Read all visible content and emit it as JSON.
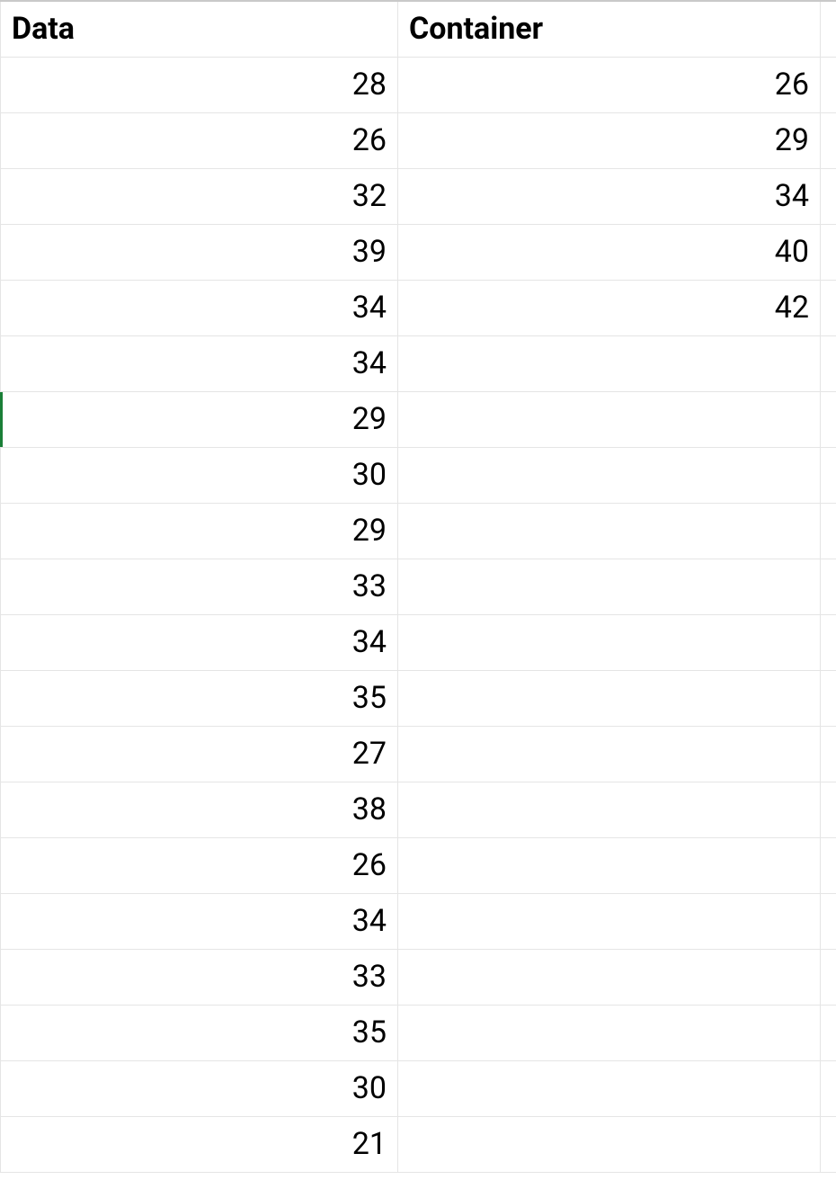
{
  "table": {
    "headers": [
      "Data",
      "Container"
    ],
    "rows": [
      {
        "data": "28",
        "container": "26"
      },
      {
        "data": "26",
        "container": "29"
      },
      {
        "data": "32",
        "container": "34"
      },
      {
        "data": "39",
        "container": "40"
      },
      {
        "data": "34",
        "container": "42"
      },
      {
        "data": "34",
        "container": ""
      },
      {
        "data": "29",
        "container": ""
      },
      {
        "data": "30",
        "container": ""
      },
      {
        "data": "29",
        "container": ""
      },
      {
        "data": "33",
        "container": ""
      },
      {
        "data": "34",
        "container": ""
      },
      {
        "data": "35",
        "container": ""
      },
      {
        "data": "27",
        "container": ""
      },
      {
        "data": "38",
        "container": ""
      },
      {
        "data": "26",
        "container": ""
      },
      {
        "data": "34",
        "container": ""
      },
      {
        "data": "33",
        "container": ""
      },
      {
        "data": "35",
        "container": ""
      },
      {
        "data": "30",
        "container": ""
      },
      {
        "data": "21",
        "container": ""
      }
    ],
    "marked_row_index": 6
  }
}
